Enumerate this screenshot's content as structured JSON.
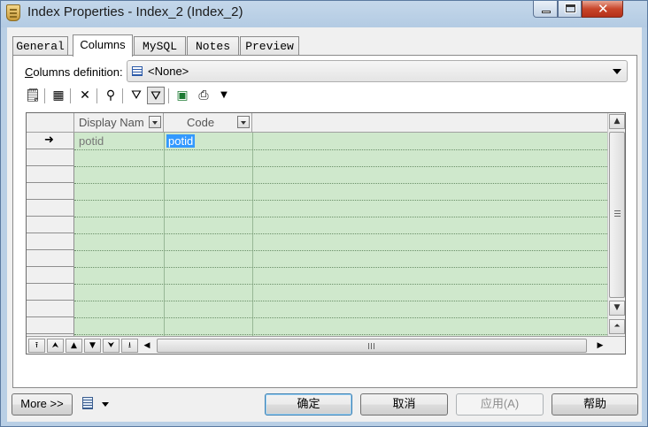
{
  "window": {
    "title": "Index Properties - Index_2 (Index_2)",
    "controls": {
      "minimize": "minimize",
      "maximize": "maximize",
      "close": "✕"
    }
  },
  "tabs": [
    {
      "label": "General",
      "active": false
    },
    {
      "label": "Columns",
      "active": true
    },
    {
      "label": "MySQL",
      "active": false
    },
    {
      "label": "Notes",
      "active": false
    },
    {
      "label": "Preview",
      "active": false
    }
  ],
  "columns_definition": {
    "label_hotkey": "C",
    "label_rest": "olumns definition:",
    "value": "<None>"
  },
  "toolbar": {
    "icons": [
      "properties-icon",
      "add-columns-icon",
      "delete-icon",
      "find-icon",
      "filter-icon",
      "filter-active-icon",
      "excel-export-icon",
      "print-icon",
      "dropdown-arrow-icon"
    ]
  },
  "grid": {
    "headers": [
      "Display Nam",
      "Code"
    ],
    "rows": [
      {
        "display_name": "potid",
        "code": "potid",
        "current": true
      }
    ],
    "empty_rows": 12,
    "current_row_marker": "➜",
    "nav_buttons": [
      "⭱",
      "⮝",
      "▲",
      "▼",
      "⮟",
      "⭳"
    ]
  },
  "buttons": {
    "more": "More >>",
    "ok": "确定",
    "cancel": "取消",
    "apply": "应用(A)",
    "help": "帮助"
  },
  "colors": {
    "grid_background": "#cfe8cc",
    "selection": "#3399ff"
  }
}
